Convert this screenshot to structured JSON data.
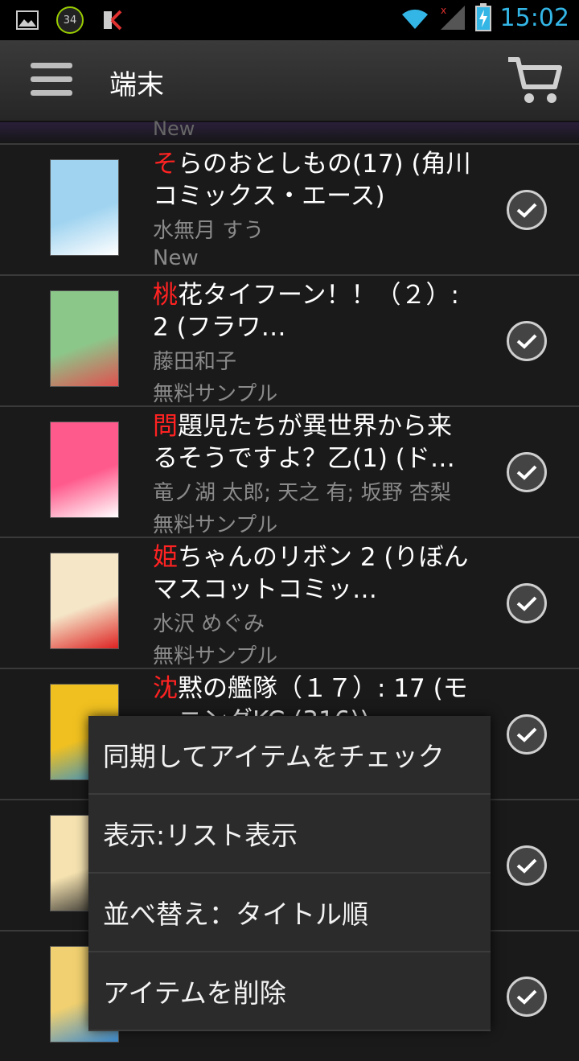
{
  "status_bar": {
    "battery_badge": "34",
    "time": "15:02"
  },
  "action_bar": {
    "title": "端末"
  },
  "partial_prev_status": "New",
  "books": [
    {
      "first": "そ",
      "rest": "らのおとしもの(17) (角川コミックス・エース)",
      "author": "水無月 すう",
      "status": "New",
      "cover": "#9fd3f0",
      "cover2": "#ffffff"
    },
    {
      "first": "桃",
      "rest": "花タイフーン！！（２）: 2 (フラワ…",
      "author": "藤田和子",
      "status": "無料サンプル",
      "cover": "#8cc78a",
      "cover2": "#e05050"
    },
    {
      "first": "問",
      "rest": "題児たちが異世界から来るそうですよ？乙(1) (ド…",
      "author": "竜ノ湖 太郎; 天之 有; 坂野 杏梨",
      "status": "無料サンプル",
      "cover": "#ff5a8c",
      "cover2": "#ffffff"
    },
    {
      "first": "姫",
      "rest": "ちゃんのリボン 2 (りぼんマスコットコミッ…",
      "author": "水沢 めぐみ",
      "status": "無料サンプル",
      "cover": "#f5e6c8",
      "cover2": "#d22"
    },
    {
      "first": "沈",
      "rest": "黙の艦隊（１７）: 17 (モーニングKC (316))",
      "author": "",
      "status": "",
      "cover": "#f0c020",
      "cover2": "#3090d0"
    },
    {
      "first": "",
      "rest": "",
      "author": "",
      "status": "",
      "cover": "#f5e2b0",
      "cover2": "#222"
    },
    {
      "first": "",
      "rest": "",
      "author": "",
      "status": "",
      "cover": "#f0d070",
      "cover2": "#3a8ad0"
    }
  ],
  "popup_menu": [
    "同期してアイテムをチェック",
    "表示:リスト表示",
    "並べ替え：タイトル順",
    "アイテムを削除"
  ]
}
